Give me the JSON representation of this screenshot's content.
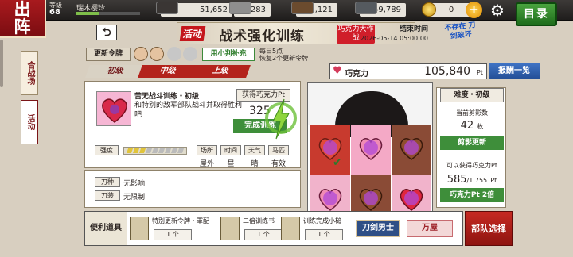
{
  "header": {
    "title_line1": "出",
    "title_line2": "阵",
    "level_label": "等级",
    "level": "68",
    "player_name": "瑞木樱玲",
    "menu_label": "目录"
  },
  "resources": [
    {
      "name": "charcoal",
      "value": "51,652",
      "color": "#3a3634"
    },
    {
      "name": "steel",
      "value": "87,283",
      "color": "#8e8e8e"
    },
    {
      "name": "coolant",
      "value": "81,121",
      "color": "#6b4b2e"
    },
    {
      "name": "whetstone",
      "value": "59,789",
      "color": "#555a5f"
    }
  ],
  "coin": {
    "value": "0",
    "plus": "+"
  },
  "side_tabs": {
    "tab1": "合战场",
    "tab2": "活动"
  },
  "banner": {
    "tag": "活动",
    "title": "战术强化训练",
    "sub": "巧克力大作战",
    "end_label": "结束时间",
    "end_time": "2026-05-14 05:00:00"
  },
  "stamp_text": "不存在 刀剑破坏",
  "orders": {
    "label": "更新令牌",
    "refill_label": "用小判补充",
    "note_line1": "每日5点",
    "note_line2": "恢复2个更新令牌"
  },
  "chocolate": {
    "label": "巧克力",
    "value": "105,840",
    "unit": "Pt"
  },
  "reward_list": "报酬一览",
  "difficulty_tabs": [
    "初级",
    "中级",
    "上级"
  ],
  "mission": {
    "title": "苦无战斗训练・初级",
    "desc": "和特别的敌军部队战斗并取得胜利吧",
    "gain_label": "获得巧克力Pt",
    "gain_value": "325",
    "done_button": "完成训练",
    "strength_label": "强度",
    "cond_keys": [
      "场所",
      "时间",
      "天气",
      "马匹"
    ],
    "cond_vals": [
      "屋外",
      "昼",
      "晴",
      "有效"
    ],
    "sword_label": "刀种",
    "sword_value": "无影响",
    "equip_label": "刀装",
    "equip_value": "无限制"
  },
  "board_check": "✔",
  "right": {
    "level": "难度・初级",
    "cuts_label": "当前剪影数",
    "cuts_value": "42",
    "cuts_unit": "枚",
    "shuffle_button": "剪影更新",
    "can_get_label": "可以获得巧克力Pt",
    "can_get_value": "585",
    "can_get_total": "/1,755",
    "can_get_unit": "Pt",
    "double_button": "巧克力Pt 2倍"
  },
  "tools": {
    "label": "便利道具",
    "items": [
      {
        "name": "特別更新令牌・軍配",
        "qty": "1 个"
      },
      {
        "name": "二倍训练书",
        "qty": "1 个"
      },
      {
        "name": "训练完成小槌",
        "qty": "1 个"
      }
    ],
    "sword_button": "刀剑男士",
    "manya_button": "万屋"
  },
  "team_button": "部队选择"
}
